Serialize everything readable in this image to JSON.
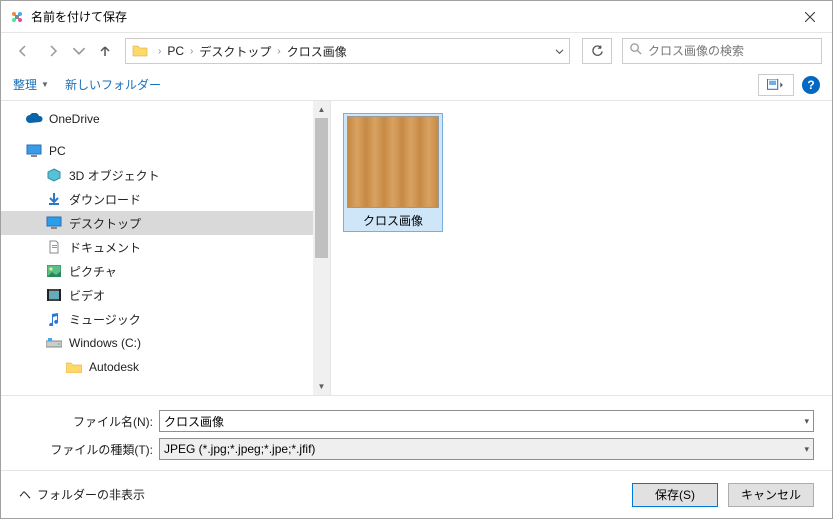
{
  "title": "名前を付けて保存",
  "breadcrumb": {
    "pc": "PC",
    "desktop": "デスクトップ",
    "folder": "クロス画像"
  },
  "search_placeholder": "クロス画像の検索",
  "toolbar": {
    "organize": "整理",
    "new_folder": "新しいフォルダー",
    "help": "?"
  },
  "tree": {
    "onedrive": "OneDrive",
    "pc": "PC",
    "objects3d": "3D オブジェクト",
    "downloads": "ダウンロード",
    "desktop": "デスクトップ",
    "documents": "ドキュメント",
    "pictures": "ピクチャ",
    "videos": "ビデオ",
    "music": "ミュージック",
    "cdrive": "Windows  (C:)",
    "autodesk": "Autodesk"
  },
  "file": {
    "name": "クロス画像"
  },
  "fields": {
    "filename_label": "ファイル名(N):",
    "filename_value": "クロス画像",
    "filetype_label": "ファイルの種類(T):",
    "filetype_value": "JPEG (*.jpg;*.jpeg;*.jpe;*.jfif)"
  },
  "footer": {
    "hide_folders": "フォルダーの非表示",
    "save": "保存(S)",
    "cancel": "キャンセル"
  }
}
